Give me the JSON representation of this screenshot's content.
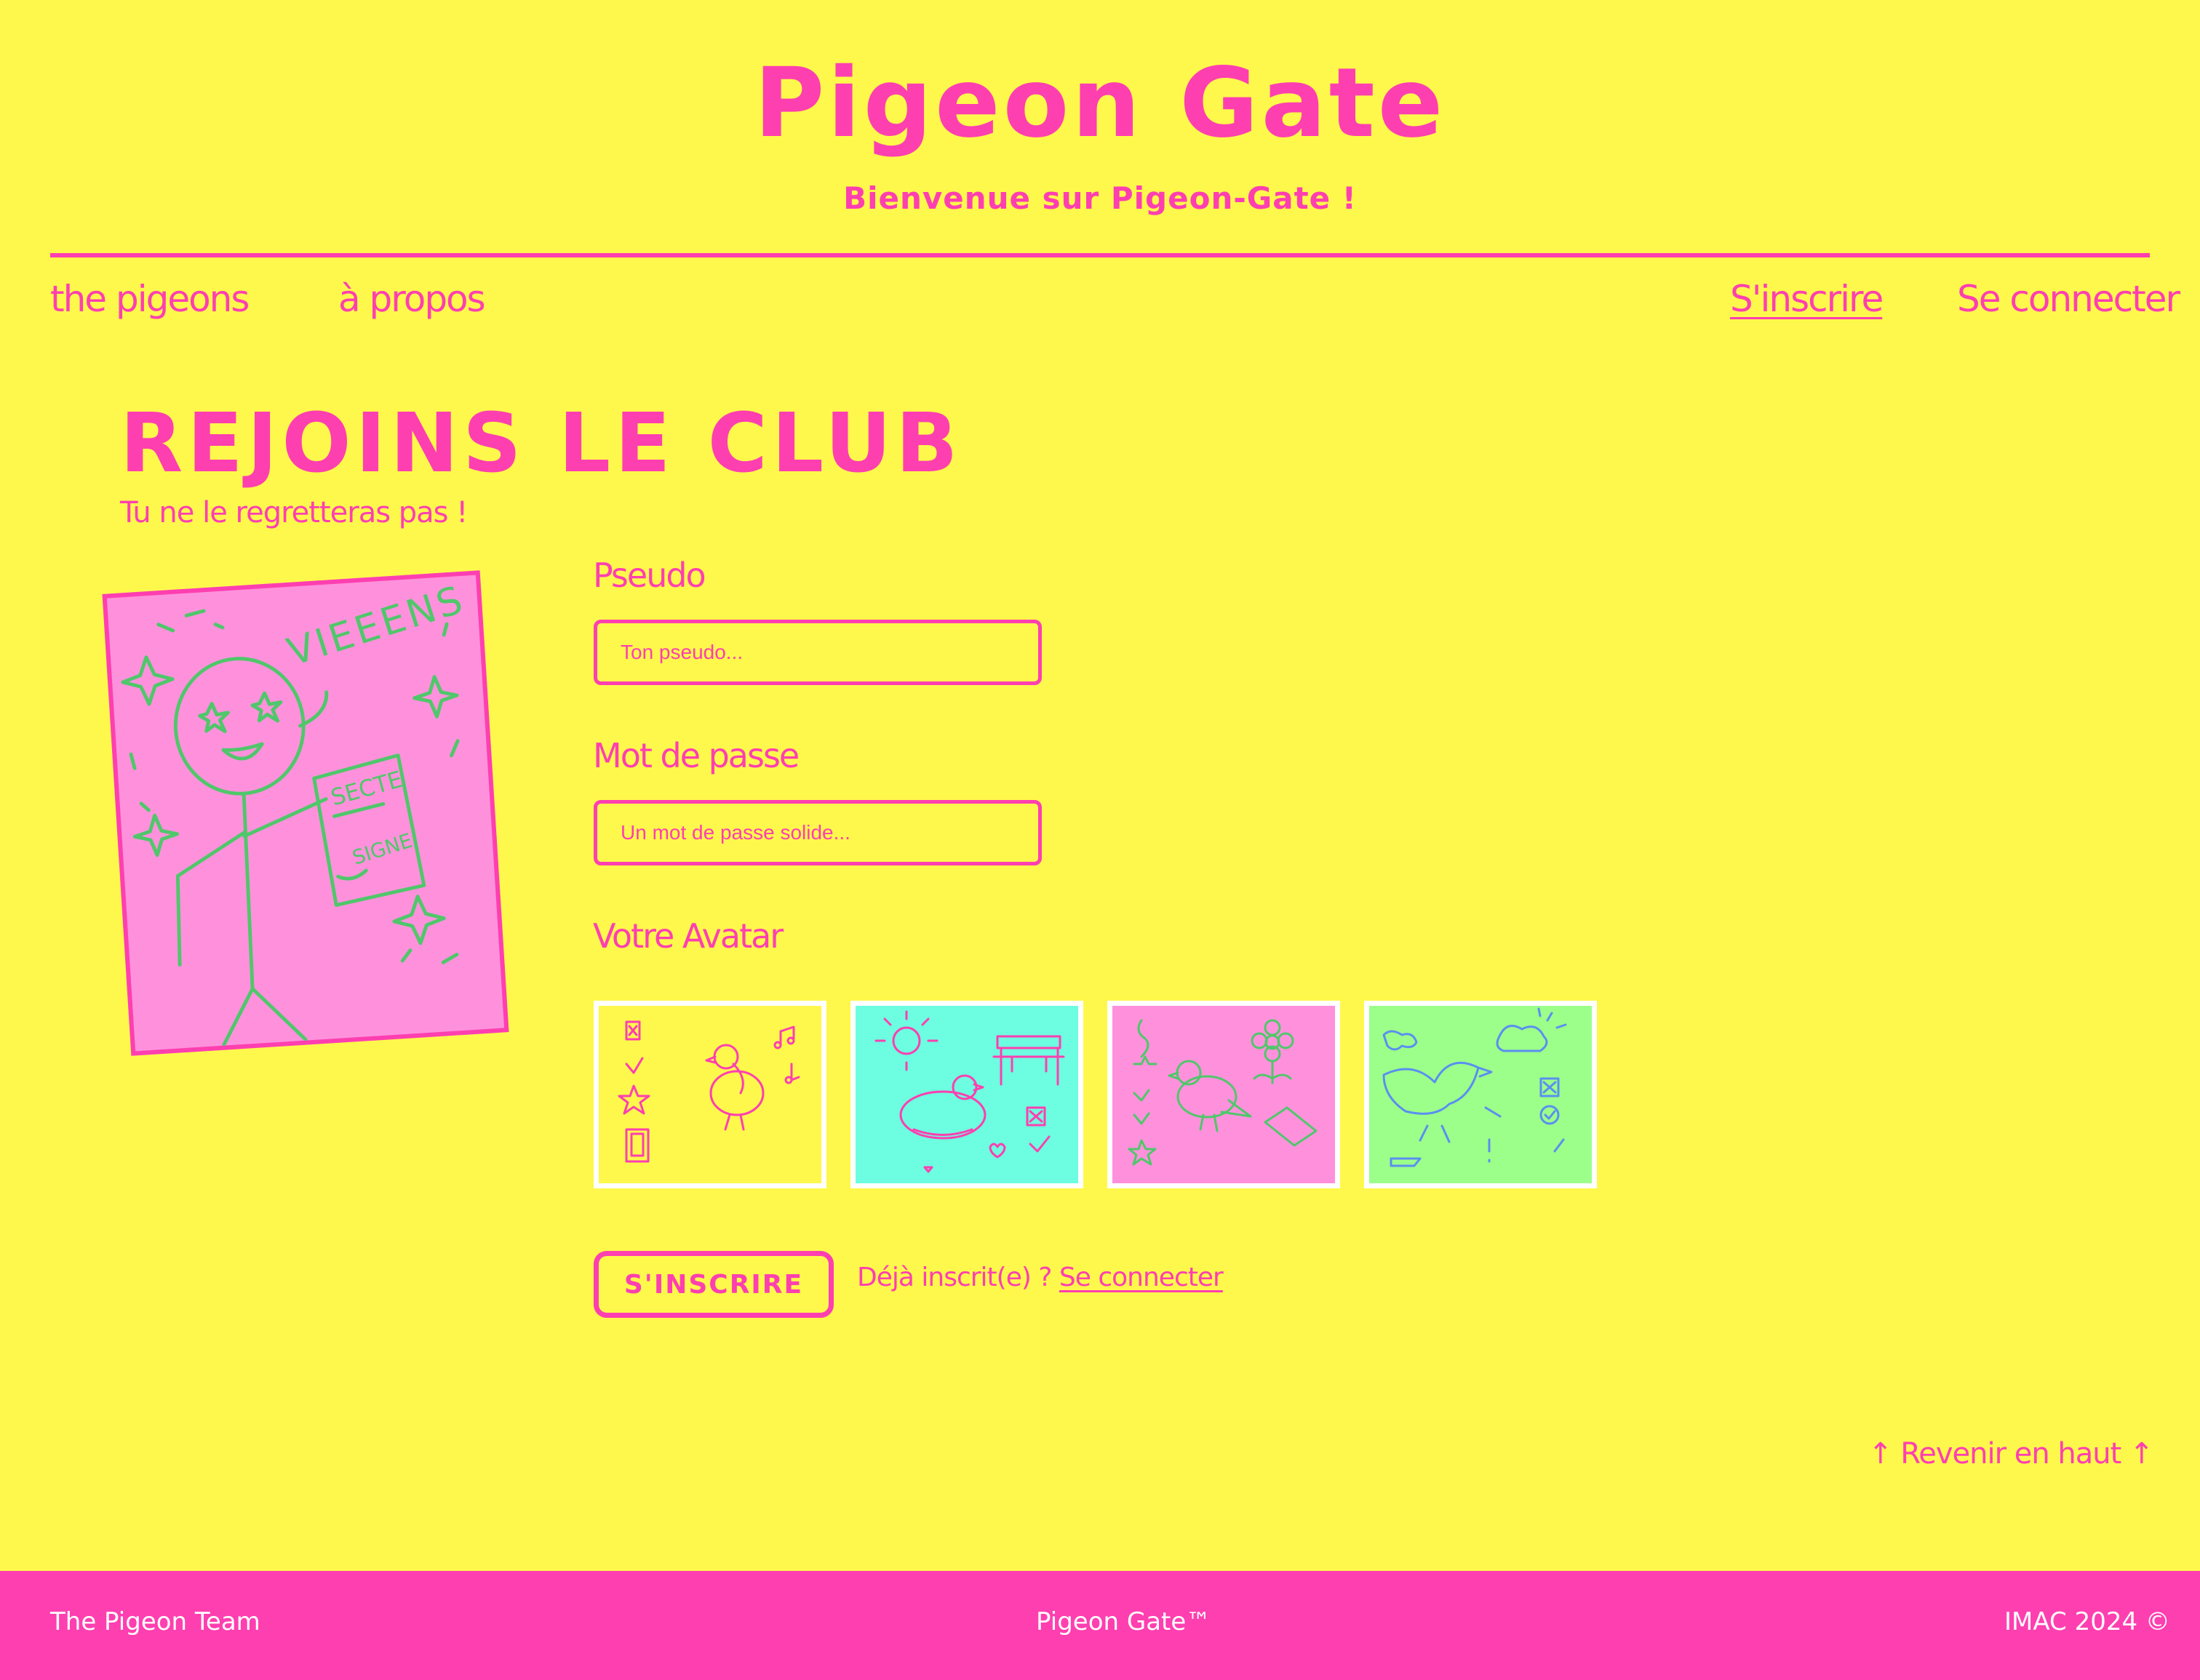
{
  "header": {
    "title": "Pigeon Gate",
    "subtitle": "Bienvenue sur Pigeon-Gate !"
  },
  "nav": {
    "left": [
      "the pigeons",
      "à propos"
    ],
    "right": [
      "S'inscrire",
      "Se connecter"
    ]
  },
  "main": {
    "heading": "REJOINS LE CLUB",
    "subheading": "Tu ne le regretteras pas !"
  },
  "illustration": {
    "texts": [
      "VIEEENS",
      "SECTE",
      "SIGNE"
    ]
  },
  "form": {
    "pseudo_label": "Pseudo",
    "pseudo_placeholder": "Ton pseudo...",
    "password_label": "Mot de passe",
    "password_placeholder": "Un mot de passe solide...",
    "avatar_label": "Votre Avatar",
    "avatars": [
      {
        "bg": "#fef84c",
        "ink": "#fe3fb0"
      },
      {
        "bg": "#6dfde0",
        "ink": "#fe3fb0"
      },
      {
        "bg": "#ff91dc",
        "ink": "#4fc76a"
      },
      {
        "bg": "#9cff8a",
        "ink": "#5a8ff0"
      }
    ],
    "submit_label": "S'INSCRIRE",
    "already_text": "Déjà inscrit(e) ?",
    "login_link": "Se connecter"
  },
  "back_to_top": "↑ Revenir en haut ↑",
  "footer": {
    "left": "The Pigeon Team",
    "center": "Pigeon Gate™",
    "right": "IMAC 2024 ©"
  },
  "colors": {
    "background": "#fef84c",
    "accent": "#fe3fb0",
    "green": "#4fc76a"
  }
}
